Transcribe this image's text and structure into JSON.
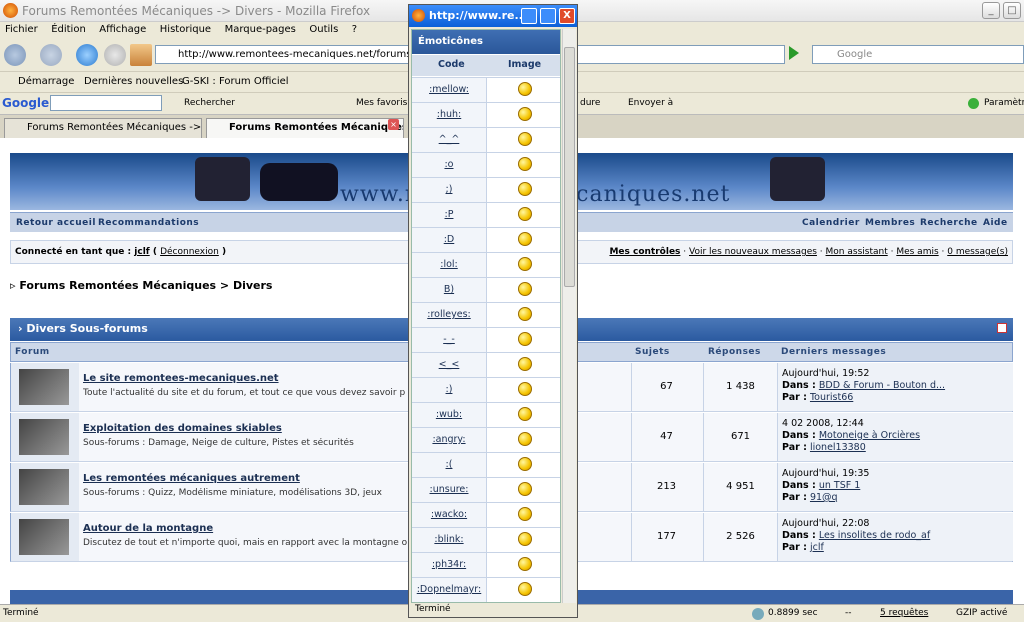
{
  "window": {
    "title": "Forums Remontées Mécaniques -> Divers - Mozilla Firefox",
    "min": "_",
    "max": "□",
    "close": "X"
  },
  "menu": [
    "Fichier",
    "Édition",
    "Affichage",
    "Historique",
    "Marque-pages",
    "Outils",
    "?"
  ],
  "nav": {
    "url": "http://www.remontees-mecaniques.net/forums/index.php?",
    "search_placeholder": "Google"
  },
  "bookmarks": [
    "Démarrage",
    "Dernières nouvelles",
    "G-SKI : Forum Officiel"
  ],
  "googlebar": {
    "logo": "Google",
    "rechercher": "Rechercher",
    "mes_favoris": "Mes favoris",
    "envoyer": "Envoyer à",
    "parametres": "Paramètres",
    "fragment": "dure"
  },
  "tabs": [
    {
      "label": "Forums Remontées Mécaniques -> Écr..."
    },
    {
      "label": "Forums Remontées Mécaniques ..."
    }
  ],
  "page": {
    "banner_text": "www.remontees-mecaniques.net",
    "nav_left": [
      "Retour accueil",
      "Recommandations"
    ],
    "nav_right": [
      "Calendrier",
      "Membres",
      "Recherche",
      "Aide"
    ],
    "user_prefix": "Connecté en tant que :",
    "user_name": "jclf",
    "logout": "Déconnexion",
    "user_links": [
      "Mes contrôles",
      "Voir les nouveaux messages",
      "Mon assistant",
      "Mes amis",
      "0 message(s)"
    ],
    "breadcrumb": "Forums Remontées Mécaniques > Divers",
    "section_title": "Divers Sous-forums",
    "columns": {
      "forum": "Forum",
      "sujets": "Sujets",
      "reponses": "Réponses",
      "derniers": "Derniers messages"
    },
    "forums": [
      {
        "title": "Le site remontees-mecaniques.net",
        "desc": "Toute l'actualité du site et du forum, et tout ce que vous devez savoir p",
        "sujets": "67",
        "reponses": "1 438",
        "date": "Aujourd'hui, 19:52",
        "dans_label": "Dans :",
        "dans": "BDD & Forum - Bouton d...",
        "par_label": "Par :",
        "par": "Tourist66"
      },
      {
        "title": "Exploitation des domaines skiables",
        "desc": "Sous-forums : Damage, Neige de culture, Pistes et sécurités",
        "sujets": "47",
        "reponses": "671",
        "date": "4 02 2008, 12:44",
        "dans_label": "Dans :",
        "dans": "Motoneige à Orcières",
        "par_label": "Par :",
        "par": "lionel13380"
      },
      {
        "title": "Les remontées mécaniques autrement",
        "desc": "Sous-forums : Quizz, Modélisme miniature, modélisations 3D, jeux",
        "sujets": "213",
        "reponses": "4 951",
        "date": "Aujourd'hui, 19:35",
        "dans_label": "Dans :",
        "dans": "un TSF 1",
        "par_label": "Par :",
        "par": "91@q"
      },
      {
        "title": "Autour de la montagne",
        "desc": "Discutez de tout et n'importe quoi, mais en rapport avec la montagne o",
        "sujets": "177",
        "reponses": "2 526",
        "date": "Aujourd'hui, 22:08",
        "dans_label": "Dans :",
        "dans": "Les insolites de rodo_af",
        "par_label": "Par :",
        "par": "jclf"
      }
    ]
  },
  "status": {
    "left": "Terminé",
    "time": "0.8899 sec",
    "dash": "--",
    "requests": "5 requêtes",
    "gzip": "GZIP activé"
  },
  "popup": {
    "title": "http://www.re...",
    "header": "Émoticônes",
    "col_code": "Code",
    "col_image": "Image",
    "codes": [
      ":mellow:",
      ":huh:",
      "^_^",
      ":o",
      ";)",
      ":P",
      ":D",
      ":lol:",
      "B)",
      ":rolleyes:",
      "-_-",
      "<_<",
      ":)",
      ":wub:",
      ":angry:",
      ":(",
      ":unsure:",
      ":wacko:",
      ":blink:",
      ":ph34r:",
      ":Dopnelmayr:"
    ],
    "status": "Terminé"
  }
}
